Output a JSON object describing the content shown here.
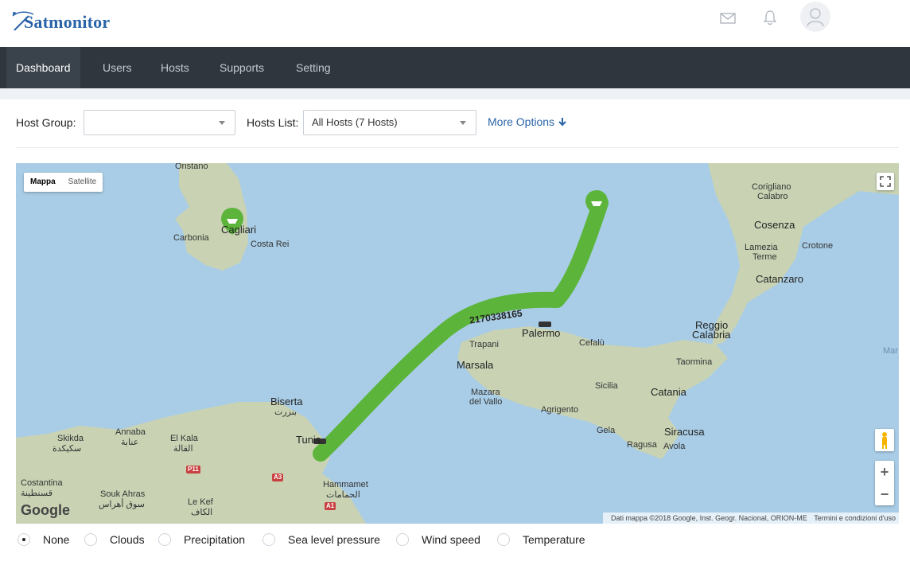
{
  "app": {
    "name": "Satmonitor"
  },
  "nav": {
    "items": [
      {
        "label": "Dashboard",
        "active": true
      },
      {
        "label": "Users"
      },
      {
        "label": "Hosts"
      },
      {
        "label": "Supports"
      },
      {
        "label": "Setting"
      }
    ]
  },
  "filters": {
    "host_group_label": "Host Group:",
    "host_group_value": "",
    "hosts_list_label": "Hosts List:",
    "hosts_list_value": "All Hosts (7 Hosts)",
    "more_options": "More Options"
  },
  "map": {
    "type_buttons": [
      "Mappa",
      "Satellite"
    ],
    "selected_type": "Mappa",
    "attribution": "Dati mappa ©2018 Google, Inst. Geogr. Nacional, ORION-ME",
    "terms": "Termini e condizioni d'uso",
    "google": "Google",
    "track_label": "2170338165",
    "places": {
      "oristano": "Oristano",
      "cagliari": "Cagliari",
      "carbonia": "Carbonia",
      "costa_rei": "Costa Rei",
      "corigliano": "Corigliano",
      "calabro": "Calabro",
      "cosenza": "Cosenza",
      "lamezia": "Lamezia",
      "terme": "Terme",
      "crotone": "Crotone",
      "catanzaro": "Catanzaro",
      "reggio": "Reggio",
      "calabria": "Calabria",
      "palermo": "Palermo",
      "trapani": "Trapani",
      "cefalu": "Cefalù",
      "marsala": "Marsala",
      "mazara": "Mazara",
      "del_vallo": "del Vallo",
      "sicilia": "Sicilia",
      "taormina": "Taormina",
      "catania": "Catania",
      "agrigento": "Agrigento",
      "gela": "Gela",
      "siracusa": "Siracusa",
      "ragusa": "Ragusa",
      "avola": "Avola",
      "biserta": "Biserta",
      "biserta_ar": "بنزرت",
      "tunis": "Tunis",
      "hammamet": "Hammamet",
      "hammamet_ar": "الحمامات",
      "skikda": "Skikda",
      "skikda_ar": "سكيكدة",
      "annaba": "Annaba",
      "annaba_ar": "عنابة",
      "el_kala": "El Kala",
      "el_kala_ar": "القالة",
      "costantina": "Costantina",
      "costantina_ar": "قسنطينة",
      "souk_ahras": "Souk Ahras",
      "souk_ahras_ar": "سوق أهراس",
      "le_kef": "Le Kef",
      "le_kef_ar": "الكاف",
      "mar": "Mar"
    },
    "roads": {
      "p11": "P11",
      "a3": "A3",
      "a1": "A1"
    }
  },
  "overlays": {
    "options": [
      "None",
      "Clouds",
      "Precipitation",
      "Sea level pressure",
      "Wind speed",
      "Temperature"
    ],
    "selected": "None"
  },
  "colors": {
    "brand": "#2a64a8",
    "nav_bg": "#2f363e",
    "track": "#5cb43a",
    "sea": "#a9cde6"
  }
}
